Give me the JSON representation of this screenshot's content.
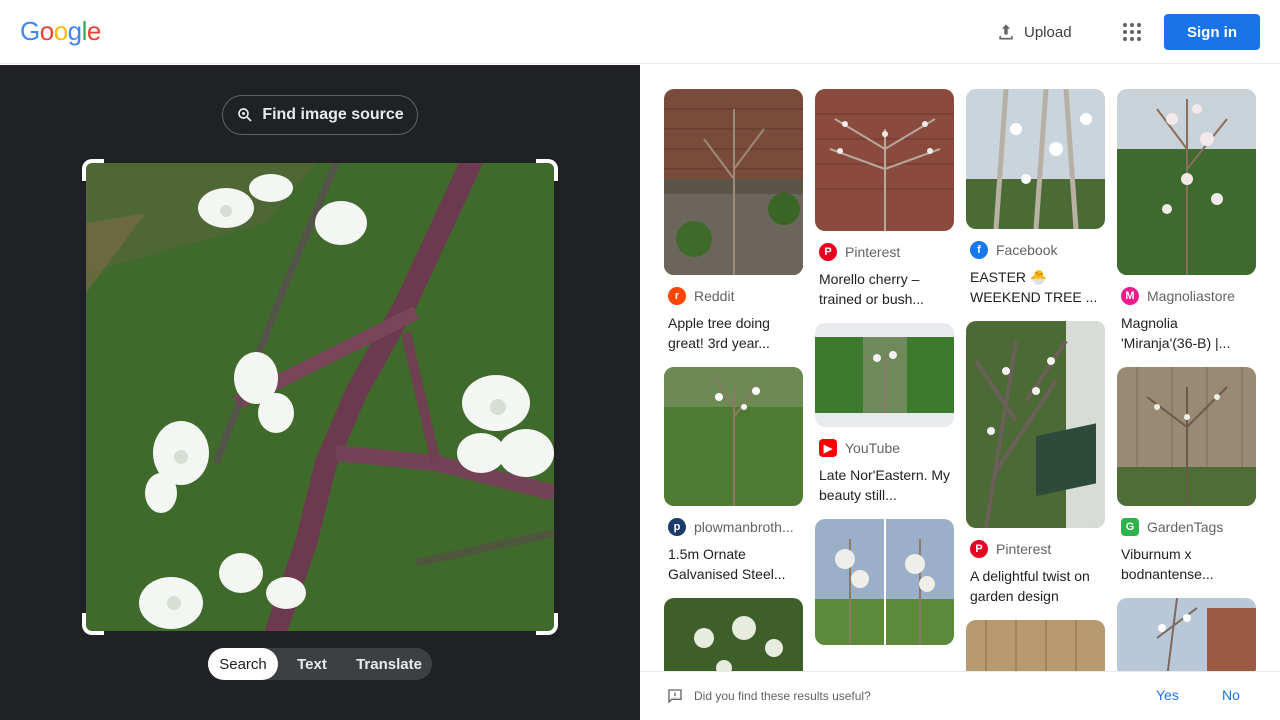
{
  "header": {
    "logo": "Google",
    "upload_label": "Upload",
    "signin_label": "Sign in"
  },
  "lens": {
    "find_source_label": "Find image source",
    "modes": [
      "Search",
      "Text",
      "Translate"
    ],
    "active_mode": "Search"
  },
  "results": [
    {
      "source": "Reddit",
      "title": "Apple tree doing great! 3rd year...",
      "favicon": "reddit-icon",
      "color": "#ff4500"
    },
    {
      "source": "plowmanbroth...",
      "title": "1.5m Ornate Galvanised Steel...",
      "favicon": "plowman-icon",
      "color": "#1a3a6b"
    },
    {
      "source": "Pinterest",
      "title": "Morello cherry – trained or bush...",
      "favicon": "pinterest-icon",
      "color": "#e60023"
    },
    {
      "source": "YouTube",
      "title": "Late Nor'Eastern. My beauty still...",
      "favicon": "youtube-icon",
      "color": "#ff0000"
    },
    {
      "source": "Facebook",
      "title": "EASTER 🐣 WEEKEND TREE ...",
      "favicon": "facebook-icon",
      "color": "#1877f2"
    },
    {
      "source": "Pinterest",
      "title": "A delightful twist on garden design",
      "favicon": "pinterest-icon",
      "color": "#e60023"
    },
    {
      "source": "Magnoliastore",
      "title": "Magnolia 'Miranja'(36-B) |...",
      "favicon": "magnolia-icon",
      "color": "#e91e8c"
    },
    {
      "source": "GardenTags",
      "title": "Viburnum x bodnantense...",
      "favicon": "gardentags-icon",
      "color": "#2db34a"
    }
  ],
  "feedback": {
    "question": "Did you find these results useful?",
    "yes": "Yes",
    "no": "No"
  }
}
